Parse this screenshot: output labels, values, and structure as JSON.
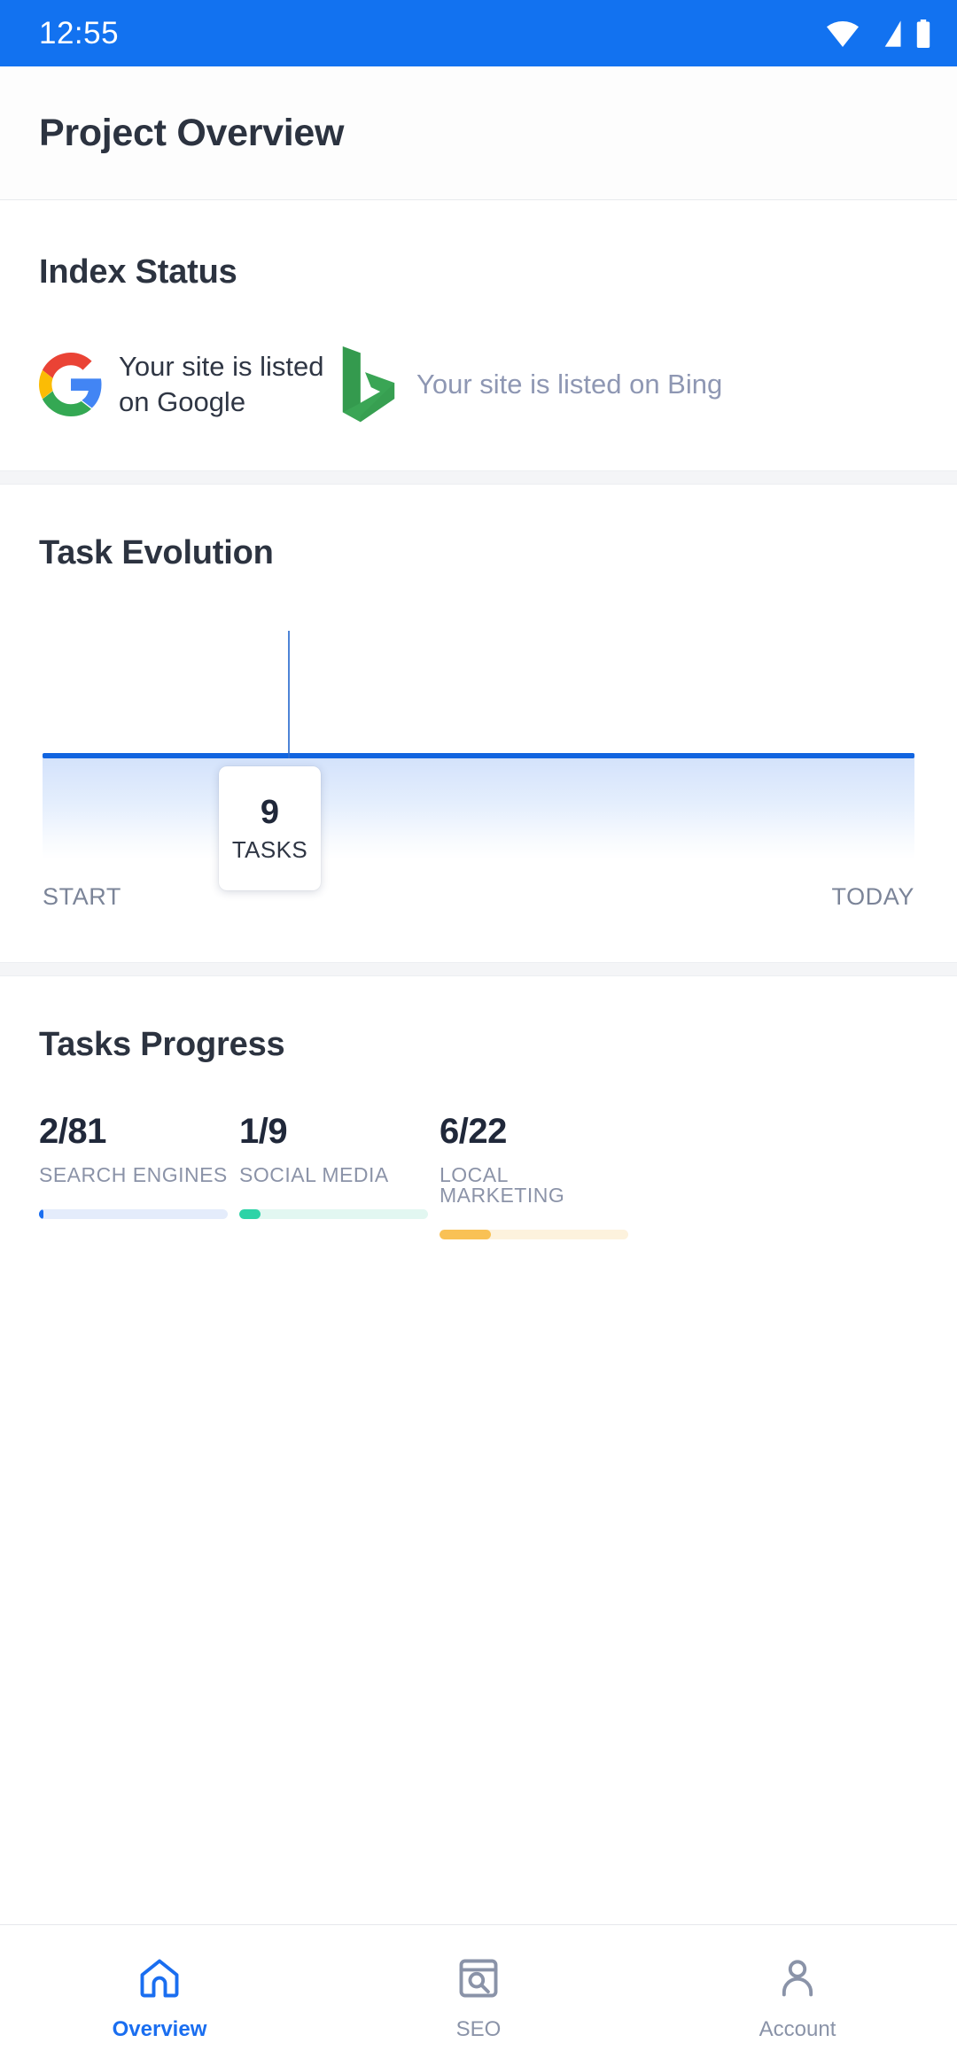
{
  "statusbar": {
    "time": "12:55",
    "icons": [
      "wifi-icon",
      "cellular-signal-icon",
      "battery-icon"
    ],
    "background": "#1272f0"
  },
  "appbar": {
    "title": "Project Overview"
  },
  "index_status": {
    "title": "Index Status",
    "items": [
      {
        "icon": "google-logo",
        "text": "Your site is listed on Google",
        "listed": true,
        "text_color": "#2f3644"
      },
      {
        "icon": "bing-logo",
        "text": "Your site is listed on Bing",
        "listed": true,
        "text_color": "#8e97b3"
      }
    ]
  },
  "task_evolution": {
    "title": "Task Evolution",
    "tooltip": {
      "value": "9",
      "label": "TASKS"
    },
    "axis_start": "START",
    "axis_today": "TODAY",
    "line_color": "#1265e0"
  },
  "tasks_progress": {
    "title": "Tasks Progress",
    "items": [
      {
        "value": "2/81",
        "label": "SEARCH ENGINES",
        "done": 2,
        "total": 81,
        "percent": 2.5,
        "fill_color": "#1a6ef0",
        "track_color": "#e4ecfb"
      },
      {
        "value": "1/9",
        "label": "SOCIAL MEDIA",
        "done": 1,
        "total": 9,
        "percent": 11.1,
        "fill_color": "#2ed3a7",
        "track_color": "#e2f7f1"
      },
      {
        "value": "6/22",
        "label": "LOCAL MARKETING",
        "done": 6,
        "total": 22,
        "percent": 27.3,
        "fill_color": "#f9c155",
        "track_color": "#fdf2dd"
      }
    ]
  },
  "bottom_nav": {
    "items": [
      {
        "icon": "home-icon",
        "label": "Overview",
        "active": true
      },
      {
        "icon": "seo-search-icon",
        "label": "SEO",
        "active": false
      },
      {
        "icon": "account-person-icon",
        "label": "Account",
        "active": false
      }
    ],
    "active_color": "#1a6ef0",
    "inactive_color": "#8a93a8"
  },
  "chart_data": {
    "type": "area",
    "title": "Task Evolution",
    "x": [
      "START",
      "TODAY"
    ],
    "xlabel": "",
    "ylabel": "Tasks",
    "series": [
      {
        "name": "Tasks",
        "values": [
          9,
          9
        ]
      }
    ],
    "annotations": [
      {
        "label": "TASKS",
        "value": 9,
        "x_fraction": 0.27
      }
    ],
    "grid": false,
    "legend": "none",
    "line_color": "#1265e0",
    "fill": "linear-gradient #d3e2fb to transparent"
  }
}
